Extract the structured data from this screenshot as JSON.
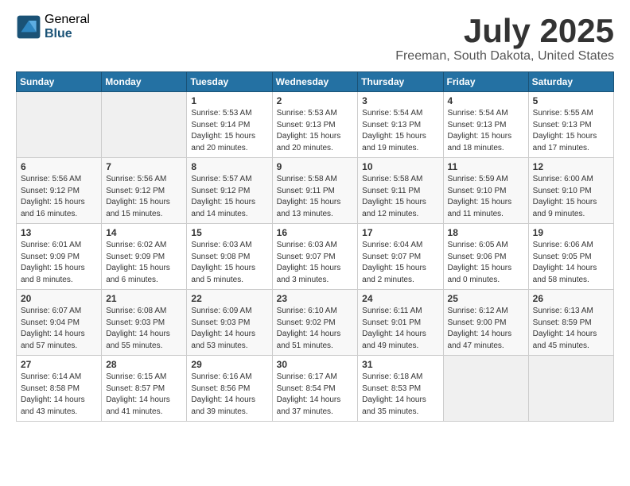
{
  "logo": {
    "general": "General",
    "blue": "Blue"
  },
  "title": "July 2025",
  "location": "Freeman, South Dakota, United States",
  "weekdays": [
    "Sunday",
    "Monday",
    "Tuesday",
    "Wednesday",
    "Thursday",
    "Friday",
    "Saturday"
  ],
  "weeks": [
    [
      {
        "day": "",
        "info": ""
      },
      {
        "day": "",
        "info": ""
      },
      {
        "day": "1",
        "info": "Sunrise: 5:53 AM\nSunset: 9:14 PM\nDaylight: 15 hours\nand 20 minutes."
      },
      {
        "day": "2",
        "info": "Sunrise: 5:53 AM\nSunset: 9:13 PM\nDaylight: 15 hours\nand 20 minutes."
      },
      {
        "day": "3",
        "info": "Sunrise: 5:54 AM\nSunset: 9:13 PM\nDaylight: 15 hours\nand 19 minutes."
      },
      {
        "day": "4",
        "info": "Sunrise: 5:54 AM\nSunset: 9:13 PM\nDaylight: 15 hours\nand 18 minutes."
      },
      {
        "day": "5",
        "info": "Sunrise: 5:55 AM\nSunset: 9:13 PM\nDaylight: 15 hours\nand 17 minutes."
      }
    ],
    [
      {
        "day": "6",
        "info": "Sunrise: 5:56 AM\nSunset: 9:12 PM\nDaylight: 15 hours\nand 16 minutes."
      },
      {
        "day": "7",
        "info": "Sunrise: 5:56 AM\nSunset: 9:12 PM\nDaylight: 15 hours\nand 15 minutes."
      },
      {
        "day": "8",
        "info": "Sunrise: 5:57 AM\nSunset: 9:12 PM\nDaylight: 15 hours\nand 14 minutes."
      },
      {
        "day": "9",
        "info": "Sunrise: 5:58 AM\nSunset: 9:11 PM\nDaylight: 15 hours\nand 13 minutes."
      },
      {
        "day": "10",
        "info": "Sunrise: 5:58 AM\nSunset: 9:11 PM\nDaylight: 15 hours\nand 12 minutes."
      },
      {
        "day": "11",
        "info": "Sunrise: 5:59 AM\nSunset: 9:10 PM\nDaylight: 15 hours\nand 11 minutes."
      },
      {
        "day": "12",
        "info": "Sunrise: 6:00 AM\nSunset: 9:10 PM\nDaylight: 15 hours\nand 9 minutes."
      }
    ],
    [
      {
        "day": "13",
        "info": "Sunrise: 6:01 AM\nSunset: 9:09 PM\nDaylight: 15 hours\nand 8 minutes."
      },
      {
        "day": "14",
        "info": "Sunrise: 6:02 AM\nSunset: 9:09 PM\nDaylight: 15 hours\nand 6 minutes."
      },
      {
        "day": "15",
        "info": "Sunrise: 6:03 AM\nSunset: 9:08 PM\nDaylight: 15 hours\nand 5 minutes."
      },
      {
        "day": "16",
        "info": "Sunrise: 6:03 AM\nSunset: 9:07 PM\nDaylight: 15 hours\nand 3 minutes."
      },
      {
        "day": "17",
        "info": "Sunrise: 6:04 AM\nSunset: 9:07 PM\nDaylight: 15 hours\nand 2 minutes."
      },
      {
        "day": "18",
        "info": "Sunrise: 6:05 AM\nSunset: 9:06 PM\nDaylight: 15 hours\nand 0 minutes."
      },
      {
        "day": "19",
        "info": "Sunrise: 6:06 AM\nSunset: 9:05 PM\nDaylight: 14 hours\nand 58 minutes."
      }
    ],
    [
      {
        "day": "20",
        "info": "Sunrise: 6:07 AM\nSunset: 9:04 PM\nDaylight: 14 hours\nand 57 minutes."
      },
      {
        "day": "21",
        "info": "Sunrise: 6:08 AM\nSunset: 9:03 PM\nDaylight: 14 hours\nand 55 minutes."
      },
      {
        "day": "22",
        "info": "Sunrise: 6:09 AM\nSunset: 9:03 PM\nDaylight: 14 hours\nand 53 minutes."
      },
      {
        "day": "23",
        "info": "Sunrise: 6:10 AM\nSunset: 9:02 PM\nDaylight: 14 hours\nand 51 minutes."
      },
      {
        "day": "24",
        "info": "Sunrise: 6:11 AM\nSunset: 9:01 PM\nDaylight: 14 hours\nand 49 minutes."
      },
      {
        "day": "25",
        "info": "Sunrise: 6:12 AM\nSunset: 9:00 PM\nDaylight: 14 hours\nand 47 minutes."
      },
      {
        "day": "26",
        "info": "Sunrise: 6:13 AM\nSunset: 8:59 PM\nDaylight: 14 hours\nand 45 minutes."
      }
    ],
    [
      {
        "day": "27",
        "info": "Sunrise: 6:14 AM\nSunset: 8:58 PM\nDaylight: 14 hours\nand 43 minutes."
      },
      {
        "day": "28",
        "info": "Sunrise: 6:15 AM\nSunset: 8:57 PM\nDaylight: 14 hours\nand 41 minutes."
      },
      {
        "day": "29",
        "info": "Sunrise: 6:16 AM\nSunset: 8:56 PM\nDaylight: 14 hours\nand 39 minutes."
      },
      {
        "day": "30",
        "info": "Sunrise: 6:17 AM\nSunset: 8:54 PM\nDaylight: 14 hours\nand 37 minutes."
      },
      {
        "day": "31",
        "info": "Sunrise: 6:18 AM\nSunset: 8:53 PM\nDaylight: 14 hours\nand 35 minutes."
      },
      {
        "day": "",
        "info": ""
      },
      {
        "day": "",
        "info": ""
      }
    ]
  ]
}
